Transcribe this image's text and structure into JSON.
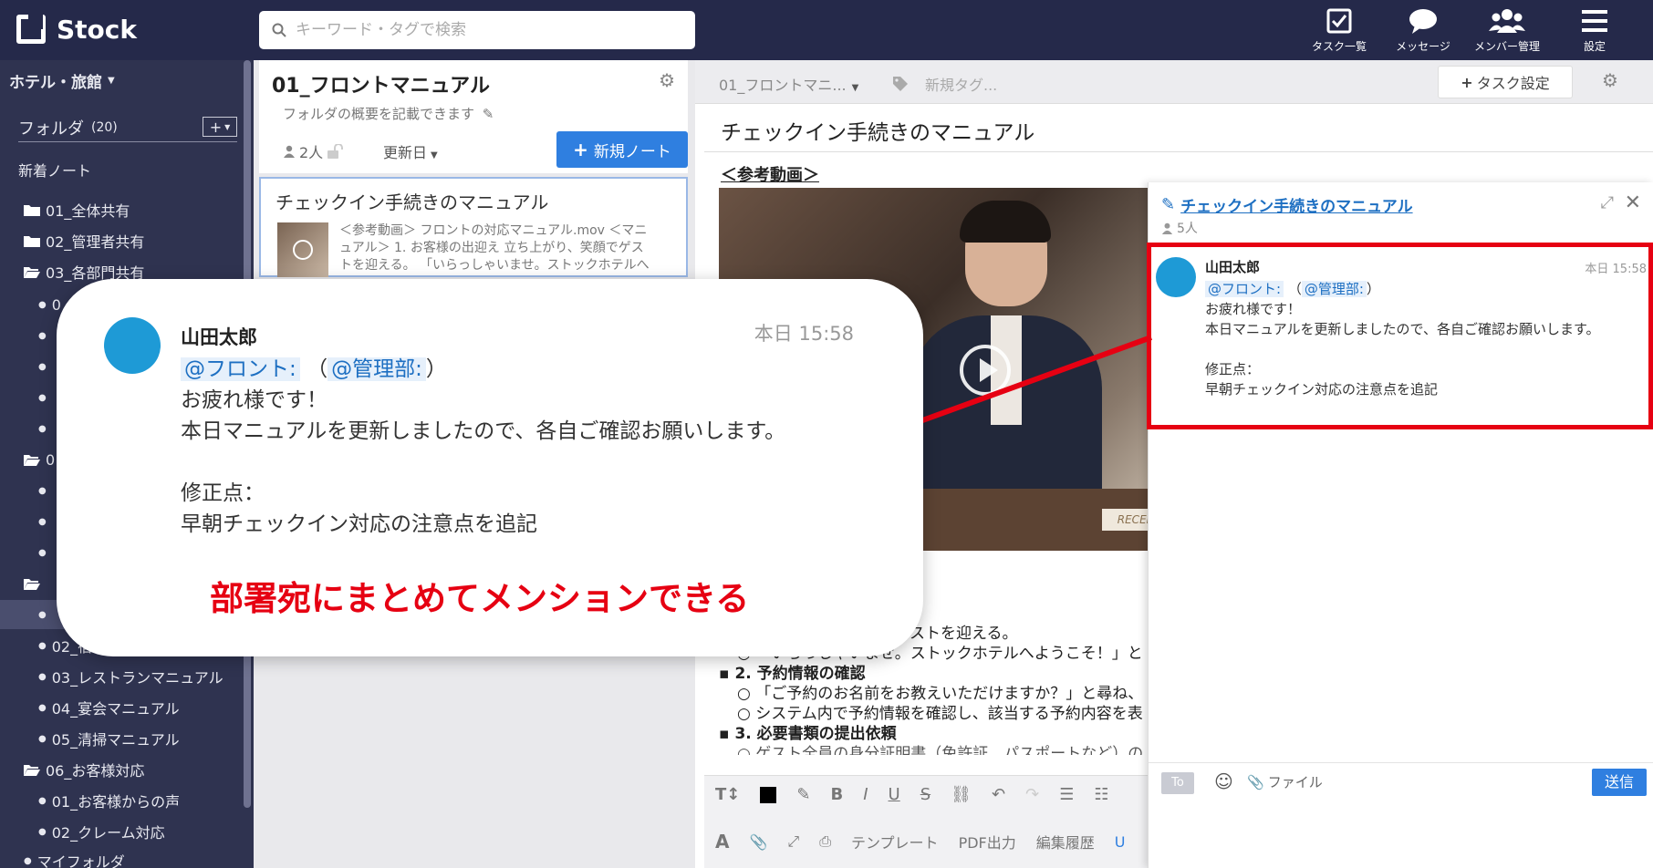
{
  "app": {
    "name": "Stock"
  },
  "search": {
    "placeholder": "キーワード・タグで検索"
  },
  "nav": [
    {
      "label": "タスク一覧",
      "icon": "task-check-icon"
    },
    {
      "label": "メッセージ",
      "icon": "message-bubble-icon"
    },
    {
      "label": "メンバー管理",
      "icon": "members-icon"
    },
    {
      "label": "設定",
      "icon": "hamburger-menu-icon"
    }
  ],
  "sidebar": {
    "workspace": "ホテル・旅館",
    "folder_label": "フォルダ",
    "folder_count": "(20)",
    "add_button": "+",
    "new_notes": "新着ノート",
    "folders": [
      {
        "label": "01_全体共有"
      },
      {
        "label": "02_管理者共有"
      },
      {
        "label": "03_各部門共有"
      }
    ],
    "sub_items_visible": [
      {
        "label": "02_宿"
      },
      {
        "label": "03_レストランマニュアル"
      },
      {
        "label": "04_宴会マニュアル"
      },
      {
        "label": "05_清掃マニュアル"
      }
    ],
    "folder6": {
      "label": "06_お客様対応"
    },
    "folder6_items": [
      {
        "label": "01_お客様からの声"
      },
      {
        "label": "02_クレーム対応"
      }
    ],
    "my_folder": "マイフォルダ",
    "partial_prefixes": {
      "letter_o": "0",
      "bullet_o": "0"
    }
  },
  "folder_panel": {
    "title": "01_フロントマニュアル",
    "description": "フォルダの概要を記載できます",
    "members": "2人",
    "sort": "更新日",
    "new_note_button": "新規ノート"
  },
  "note_card": {
    "title": "チェックイン手続きのマニュアル",
    "excerpt_1": "＜参考動画＞ フロントの対応マニュアル.mov ＜マニ",
    "excerpt_2": "ュアル＞ 1. お客様の出迎え 立ち上がり、笑顔でゲス",
    "excerpt_3": "トを迎える。 「いらっしゃいませ。ストックホテルへ"
  },
  "editor": {
    "breadcrumb": "01_フロントマニ...",
    "tag_placeholder": "新規タグ...",
    "task_button": "タスク設定",
    "title": "チェックイン手続きのマニュアル",
    "ref_heading": "＜参考動画＞",
    "video_sign": "RECEPT",
    "body": {
      "line_greet": "ゲストを迎える。",
      "line_welcome": "「いらっしゃいませ。ストックホテルへようこそ！」と",
      "h2": "2. 予約情報の確認",
      "line_ask": "「ご予約のお名前をお教えいただけますか？」と尋ね、",
      "line_system": "システム内で予約情報を確認し、該当する予約内容を表",
      "h3": "3. 必要書類の提出依頼",
      "line_docs": "ゲスト全員の身分証明書（免許証、パスポートなど）の"
    },
    "toolbar2": {
      "template": "テンプレート",
      "pdf": "PDF出力",
      "history": "編集履歴",
      "u": "U"
    }
  },
  "comment_panel": {
    "title": "チェックイン手続きのマニュアル",
    "members": "5人",
    "comment": {
      "author": "山田太郎",
      "time": "本日 15:58",
      "mention1": "@フロント:",
      "mention2": "@管理部:",
      "open_paren": "（",
      "close_paren": "）",
      "line1": "お疲れ様です！",
      "line2": "本日マニュアルを更新しましたので、各自ご確認お願いします。",
      "line3": "修正点：",
      "line4": "早朝チェックイン対応の注意点を追記"
    },
    "to_label": "To",
    "file_label": "ファイル",
    "send_button": "送信"
  },
  "callout": {
    "author": "山田太郎",
    "time": "本日 15:58",
    "mention1": "@フロント:",
    "mention2": "@管理部:",
    "open_paren": "（",
    "close_paren": "）",
    "line1": "お疲れ様です！",
    "line2": "本日マニュアルを更新しましたので、各自ご確認お願いします。",
    "line3": "修正点：",
    "line4": "早朝チェックイン対応の注意点を追記",
    "caption": "部署宛にまとめてメンションできる"
  },
  "colors": {
    "topbar": "#25294a",
    "sidebar": "#2f3350",
    "accent_blue": "#2f7fe0",
    "highlight_red": "#e60012",
    "avatar": "#1e9ad6"
  }
}
